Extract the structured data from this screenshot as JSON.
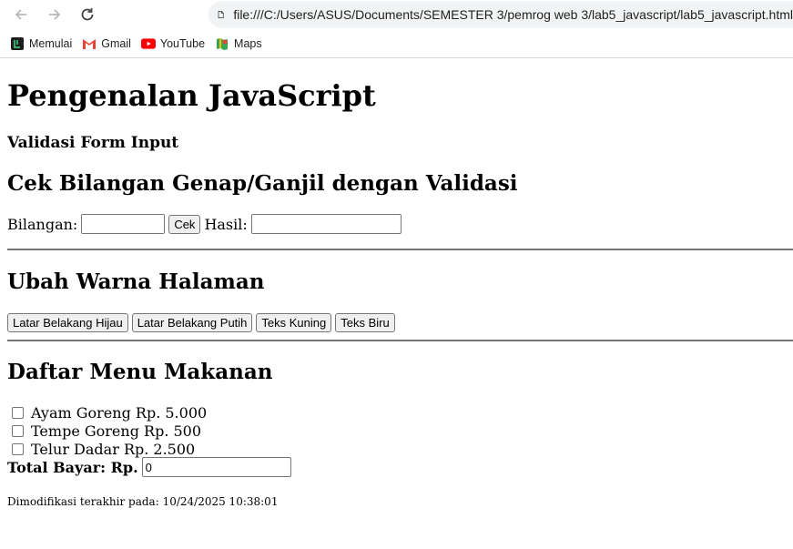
{
  "browser": {
    "url": "file:///C:/Users/ASUS/Documents/SEMESTER 3/pemrog web 3/lab5_javascript/lab5_javascript.html",
    "bookmarks": [
      {
        "label": "Memulai",
        "icon": "memulai-icon"
      },
      {
        "label": "Gmail",
        "icon": "gmail-icon"
      },
      {
        "label": "YouTube",
        "icon": "youtube-icon"
      },
      {
        "label": "Maps",
        "icon": "maps-icon"
      }
    ]
  },
  "page": {
    "title": "Pengenalan JavaScript",
    "subtitle": "Validasi Form Input"
  },
  "parity": {
    "heading": "Cek Bilangan Genap/Ganjil dengan Validasi",
    "number_label": "Bilangan:",
    "number_value": "",
    "check_label": "Cek",
    "result_label": "Hasil:",
    "result_value": ""
  },
  "colors": {
    "heading": "Ubah Warna Halaman",
    "buttons": [
      "Latar Belakang Hijau",
      "Latar Belakang Putih",
      "Teks Kuning",
      "Teks Biru"
    ]
  },
  "menu": {
    "heading": "Daftar Menu Makanan",
    "items": [
      "Ayam Goreng Rp. 5.000",
      "Tempe Goreng Rp. 500",
      "Telur Dadar Rp. 2.500"
    ],
    "total_label": "Total Bayar: Rp.",
    "total_value": "0"
  },
  "footer": {
    "label": "Dimodifikasi terakhir pada:",
    "timestamp": "10/24/2025 10:38:01"
  }
}
